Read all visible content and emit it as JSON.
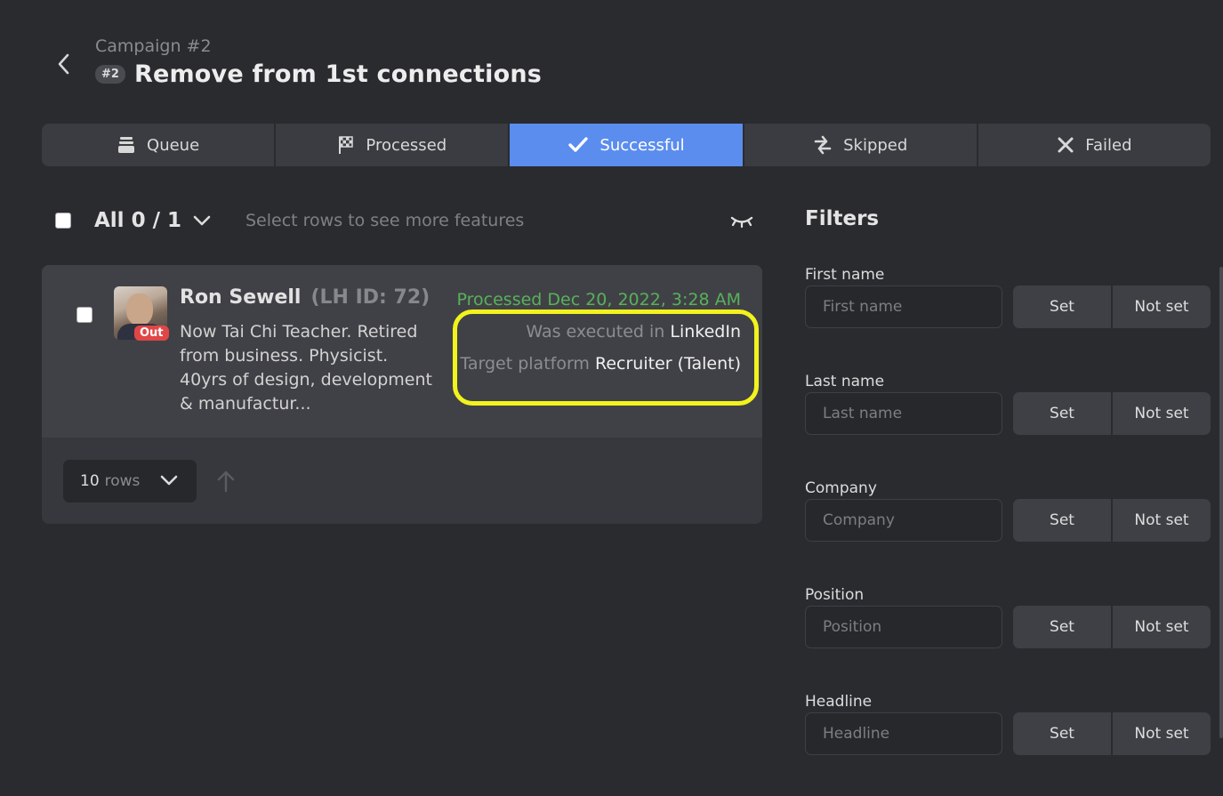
{
  "header": {
    "breadcrumb": "Campaign #2",
    "badge": "#2",
    "title": "Remove from 1st connections"
  },
  "tabs": [
    {
      "label": "Queue",
      "icon": "queue-stack-icon",
      "active": false
    },
    {
      "label": "Processed",
      "icon": "checkered-flag-icon",
      "active": false
    },
    {
      "label": "Successful",
      "icon": "checkmark-icon",
      "active": true
    },
    {
      "label": "Skipped",
      "icon": "swap-arrows-icon",
      "active": false
    },
    {
      "label": "Failed",
      "icon": "x-icon",
      "active": false
    }
  ],
  "list": {
    "all_label": "All 0 / 1",
    "hint": "Select rows to see more features",
    "rows": [
      {
        "name": "Ron Sewell",
        "lh_id": "(LH ID: 72)",
        "badge": "Out",
        "headline": "Now Tai Chi Teacher. Retired from business. Physicist. 40yrs of design, development & manufactur...",
        "processed": "Processed Dec 20, 2022, 3:28 AM",
        "executed_label": "Was executed in",
        "executed_value": "LinkedIn",
        "platform_label": "Target platform",
        "platform_value": "Recruiter (Talent)"
      }
    ]
  },
  "pagination": {
    "rows_count": "10",
    "rows_unit": "rows"
  },
  "filters": {
    "title": "Filters",
    "set_label": "Set",
    "not_set_label": "Not set",
    "fields": [
      {
        "label": "First name",
        "placeholder": "First name"
      },
      {
        "label": "Last name",
        "placeholder": "Last name"
      },
      {
        "label": "Company",
        "placeholder": "Company"
      },
      {
        "label": "Position",
        "placeholder": "Position"
      },
      {
        "label": "Headline",
        "placeholder": "Headline"
      }
    ]
  },
  "colors": {
    "background": "#2a2b2f",
    "accent": "#5b8def",
    "success_text": "#58b15b",
    "out_badge": "#e04646",
    "highlight": "#f2f21e"
  }
}
